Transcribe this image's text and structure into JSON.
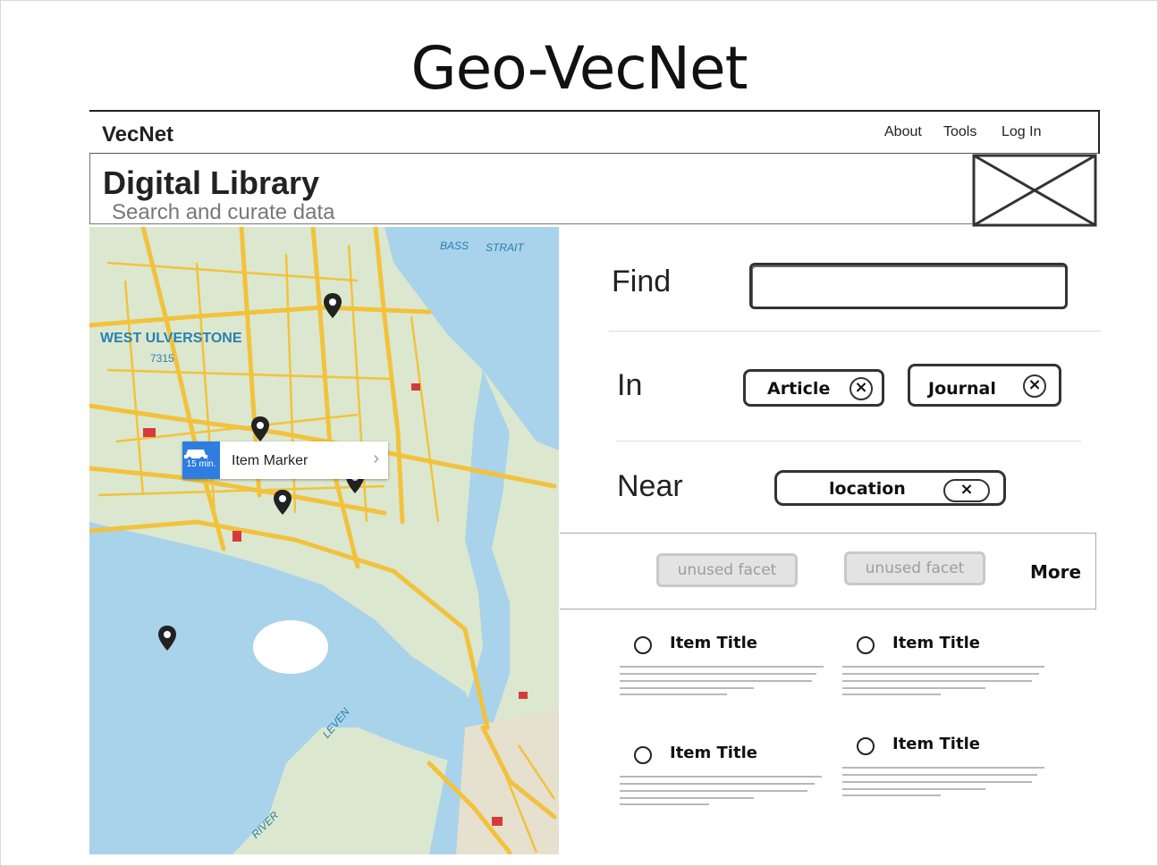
{
  "slide": {
    "title": "Geo-VecNet"
  },
  "navbar": {
    "brand": "VecNet",
    "links": [
      "About",
      "Tools",
      "Log In"
    ]
  },
  "header": {
    "title": "Digital Library",
    "subtitle": "Search and curate data"
  },
  "map": {
    "labels": [
      "WEST ULVERSTONE",
      "7315",
      "BASS",
      "STRAIT",
      "LEVEN",
      "RIVER"
    ],
    "callout": {
      "badge": "15 min.",
      "text": "Item Marker",
      "chevron": "›"
    }
  },
  "search": {
    "find_label": "Find",
    "find_value": "",
    "in_label": "In",
    "in_chips": [
      {
        "label": "Article"
      },
      {
        "label": "Journal"
      }
    ],
    "near_label": "Near",
    "near_chip": {
      "label": "location"
    },
    "close_glyph": "×"
  },
  "facets": {
    "items": [
      "unused facet",
      "unused facet"
    ],
    "more_label": "More"
  },
  "results": [
    {
      "title": "Item Title"
    },
    {
      "title": "Item Title"
    },
    {
      "title": "Item Title"
    },
    {
      "title": "Item Title"
    }
  ],
  "colors": {
    "map_water": "#a9d3ea",
    "map_land": "#dbe8cf",
    "map_road": "#f2c23d",
    "pin": "#222222",
    "callout_badge": "#2f7de1",
    "facet_disabled": "#e3e3e3"
  }
}
